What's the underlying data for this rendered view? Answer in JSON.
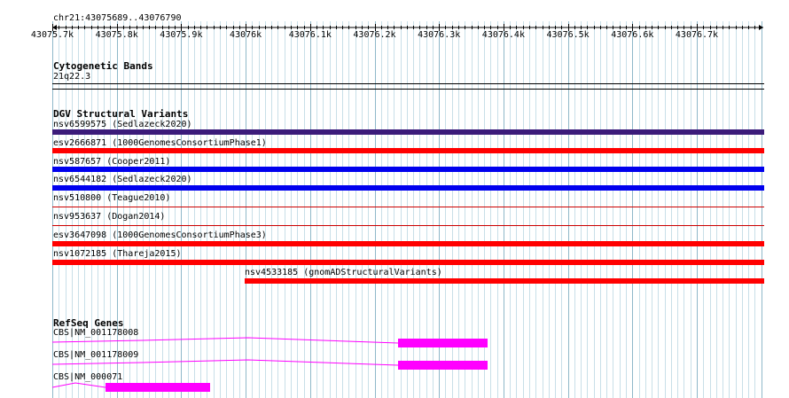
{
  "ruler": {
    "region_label": "chr21:43075689..43076790",
    "ticks": [
      "43075.7k",
      "43075.8k",
      "43075.9k",
      "43076k",
      "43076.1k",
      "43076.2k",
      "43076.3k",
      "43076.4k",
      "43076.5k",
      "43076.6k",
      "43076.7k"
    ]
  },
  "cytobands": {
    "title": "Cytogenetic Bands",
    "band": "21q22.3"
  },
  "dgv": {
    "title": "DGV Structural Variants",
    "variants": [
      {
        "label": "nsv6599575 (Sedlazeck2020)",
        "color": "#3b1b7a"
      },
      {
        "label": "esv2666871 (1000GenomesConsortiumPhase1)",
        "color": "#ff0000"
      },
      {
        "label": "nsv587657 (Cooper2011)",
        "color": "#0000ee"
      },
      {
        "label": "nsv6544182 (Sedlazeck2020)",
        "color": "#0000ee"
      },
      {
        "label": "nsv510800 (Teague2010)",
        "color": "#cc0000"
      },
      {
        "label": "nsv953637 (Dogan2014)",
        "color": "#cc0000"
      },
      {
        "label": "esv3647098 (1000GenomesConsortiumPhase3)",
        "color": "#ff0000"
      },
      {
        "label": "nsv1072185 (Thareja2015)",
        "color": "#ff0000"
      },
      {
        "label": "nsv4533185 (gnomADStructuralVariants)",
        "color": "#ff0000"
      }
    ]
  },
  "refseq": {
    "title": "RefSeq Genes",
    "color": "#ff00ff",
    "genes": [
      {
        "label": "CBS|NM_001178008"
      },
      {
        "label": "CBS|NM_001178009"
      },
      {
        "label": "CBS|NM_000071"
      }
    ]
  },
  "colors": {
    "grid_major": "#8fb8c9",
    "grid_minor": "#c8dfe8"
  }
}
